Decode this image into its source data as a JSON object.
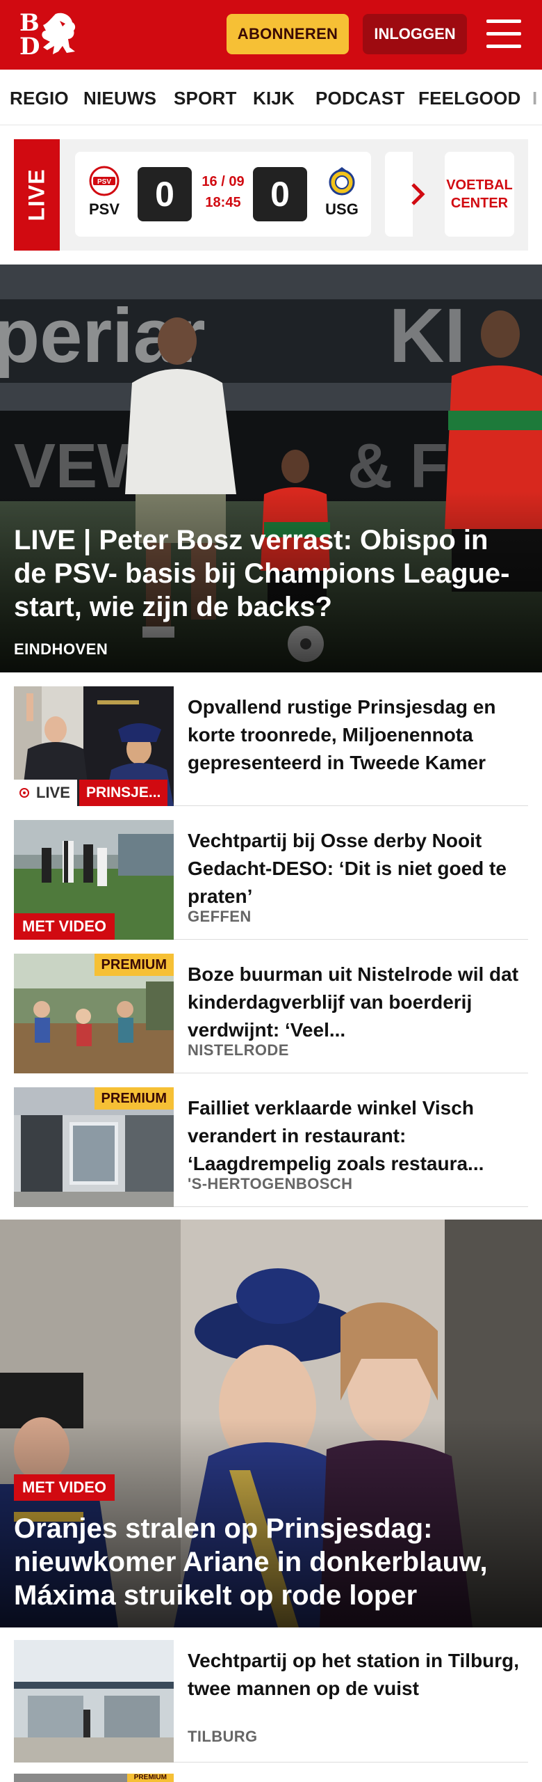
{
  "header": {
    "logo_top": "B",
    "logo_bottom": "D",
    "subscribe_label": "ABONNEREN",
    "login_label": "INLOGGEN"
  },
  "nav": {
    "items": [
      "REGIO",
      "NIEUWS",
      "SPORT",
      "KIJK",
      "PODCAST",
      "FEELGOOD",
      "I"
    ]
  },
  "live_widget": {
    "label": "LIVE",
    "home_team": "PSV",
    "away_team": "USG",
    "home_score": "0",
    "away_score": "0",
    "date": "16 / 09",
    "time": "18:45",
    "voetbal_center": "VOETBAL CENTER"
  },
  "hero": {
    "title": "LIVE | Peter Bosz verrast: Obispo in de PSV- basis bij Champions League-start, wie zijn de backs?",
    "location": "EINDHOVEN"
  },
  "articles": [
    {
      "title": "Opvallend rustige Prinsjesdag en korte troonrede, Miljoenennota gepresenteerd in Tweede Kamer",
      "live_label": "LIVE",
      "tag": "PRINSJE..."
    },
    {
      "title": "Vechtpartij bij Osse derby Nooit Gedacht-DESO: ‘Dit is niet goed te praten’",
      "location": "GEFFEN",
      "badge": "MET VIDEO"
    },
    {
      "title": "Boze buurman uit Nistelrode wil dat kinderdagverblijf van boerderij verdwijnt: ‘Veel...",
      "location": "NISTELRODE",
      "badge": "PREMIUM"
    },
    {
      "title": "Failliet verklaarde winkel Visch verandert in restaurant: ‘Laagdrempelig zoals restaura...",
      "location": "'S-HERTOGENBOSCH",
      "badge": "PREMIUM"
    }
  ],
  "hero2": {
    "badge": "MET VIDEO",
    "title": "Oranjes stralen op Prinsjesdag: nieuwkomer Ariane in donkerblauw, Máxima struikelt op rode loper"
  },
  "article_last": {
    "title": "Vechtpartij op het station in Tilburg, twee mannen op de vuist",
    "location": "TILBURG",
    "next_badge": "PREMIUM"
  },
  "colors": {
    "brand_red": "#d10a11",
    "dark_red": "#9e0a10",
    "premium_yellow": "#f6c035"
  }
}
